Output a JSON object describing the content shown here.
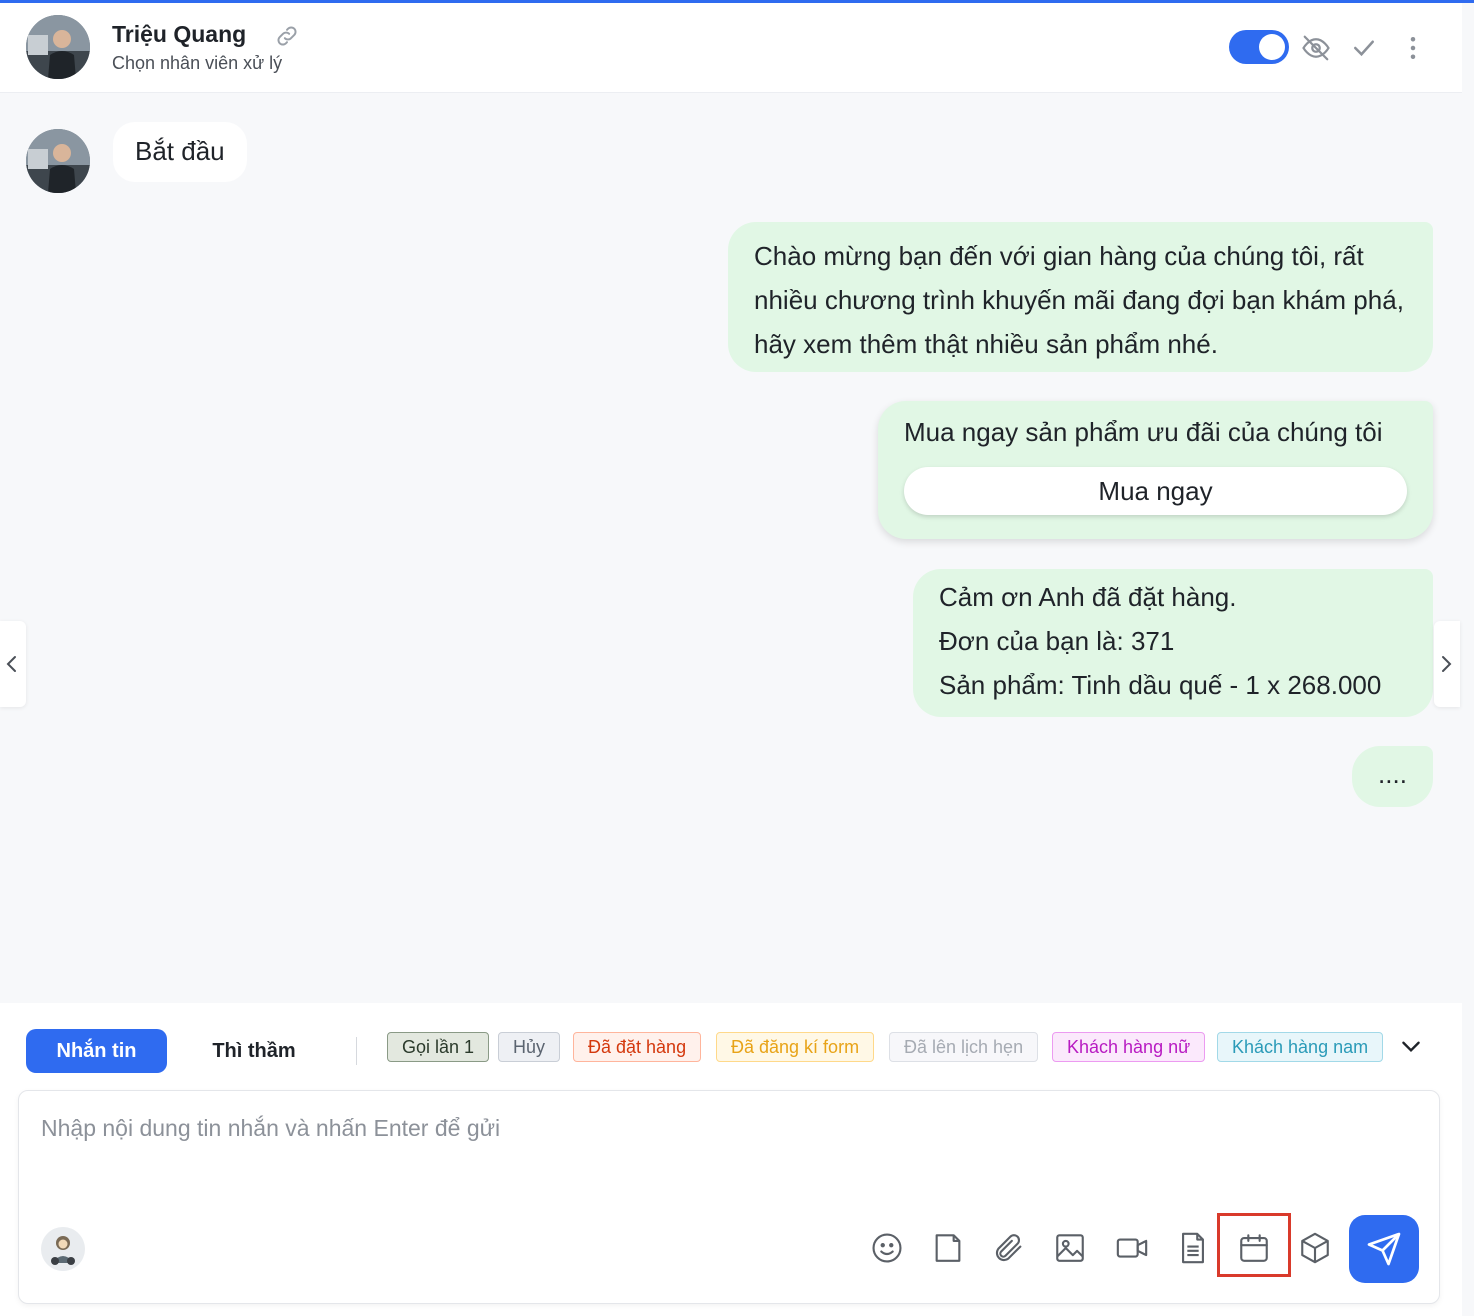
{
  "header": {
    "name": "Triệu Quang",
    "subtitle": "Chọn nhân viên xử lý",
    "toggle_on": true
  },
  "messages": {
    "incoming": "Bắt đầu",
    "welcome": "Chào mừng bạn đến với gian hàng của chúng tôi, rất nhiều chương trình khuyến mãi đang đợi bạn khám phá, hãy xem thêm thật nhiều sản phẩm nhé.",
    "promo_text": "Mua ngay sản phẩm ưu đãi của chúng tôi",
    "promo_button": "Mua ngay",
    "order_line1": "Cảm ơn Anh đã đặt hàng.",
    "order_line2": "Đơn của bạn là: 371",
    "order_line3": "Sản phẩm: Tinh dầu quế - 1 x 268.000",
    "typing": "...."
  },
  "composer": {
    "tab_message": "Nhắn tin",
    "tab_whisper": "Thì thầm",
    "tags": [
      {
        "label": "Gọi lần 1",
        "color": "#2b3a2b",
        "bg": "#e3e8df",
        "border": "#8a9a86"
      },
      {
        "label": "Hủy",
        "color": "#5b6470",
        "bg": "#eef0f4",
        "border": "#c9ced6"
      },
      {
        "label": "Đã đặt hàng",
        "color": "#d4380d",
        "bg": "#fff1ec",
        "border": "#ffb59c"
      },
      {
        "label": "Đã đăng kí form",
        "color": "#e8a317",
        "bg": "#fff8e6",
        "border": "#ffd98a"
      },
      {
        "label": "Đã lên lịch hẹn",
        "color": "#a6abb3",
        "bg": "#f7f7fa",
        "border": "#dde0e6"
      },
      {
        "label": "Khách hàng nữ",
        "color": "#b81bc2",
        "bg": "#fbe9fc",
        "border": "#ec9bf1"
      },
      {
        "label": "Khách hàng nam",
        "color": "#2b9bb8",
        "bg": "#e8f6fa",
        "border": "#a2d9e8"
      }
    ],
    "placeholder": "Nhập nội dung tin nhắn và nhấn Enter để gửi",
    "tools": [
      "smile-icon",
      "note-icon",
      "paperclip-icon",
      "image-icon",
      "video-icon",
      "document-icon",
      "calendar-icon",
      "package-icon"
    ]
  },
  "colors": {
    "accent": "#2f6bf0",
    "outgoing_bubble": "#e1f7e5",
    "highlight": "#d93a2b"
  }
}
